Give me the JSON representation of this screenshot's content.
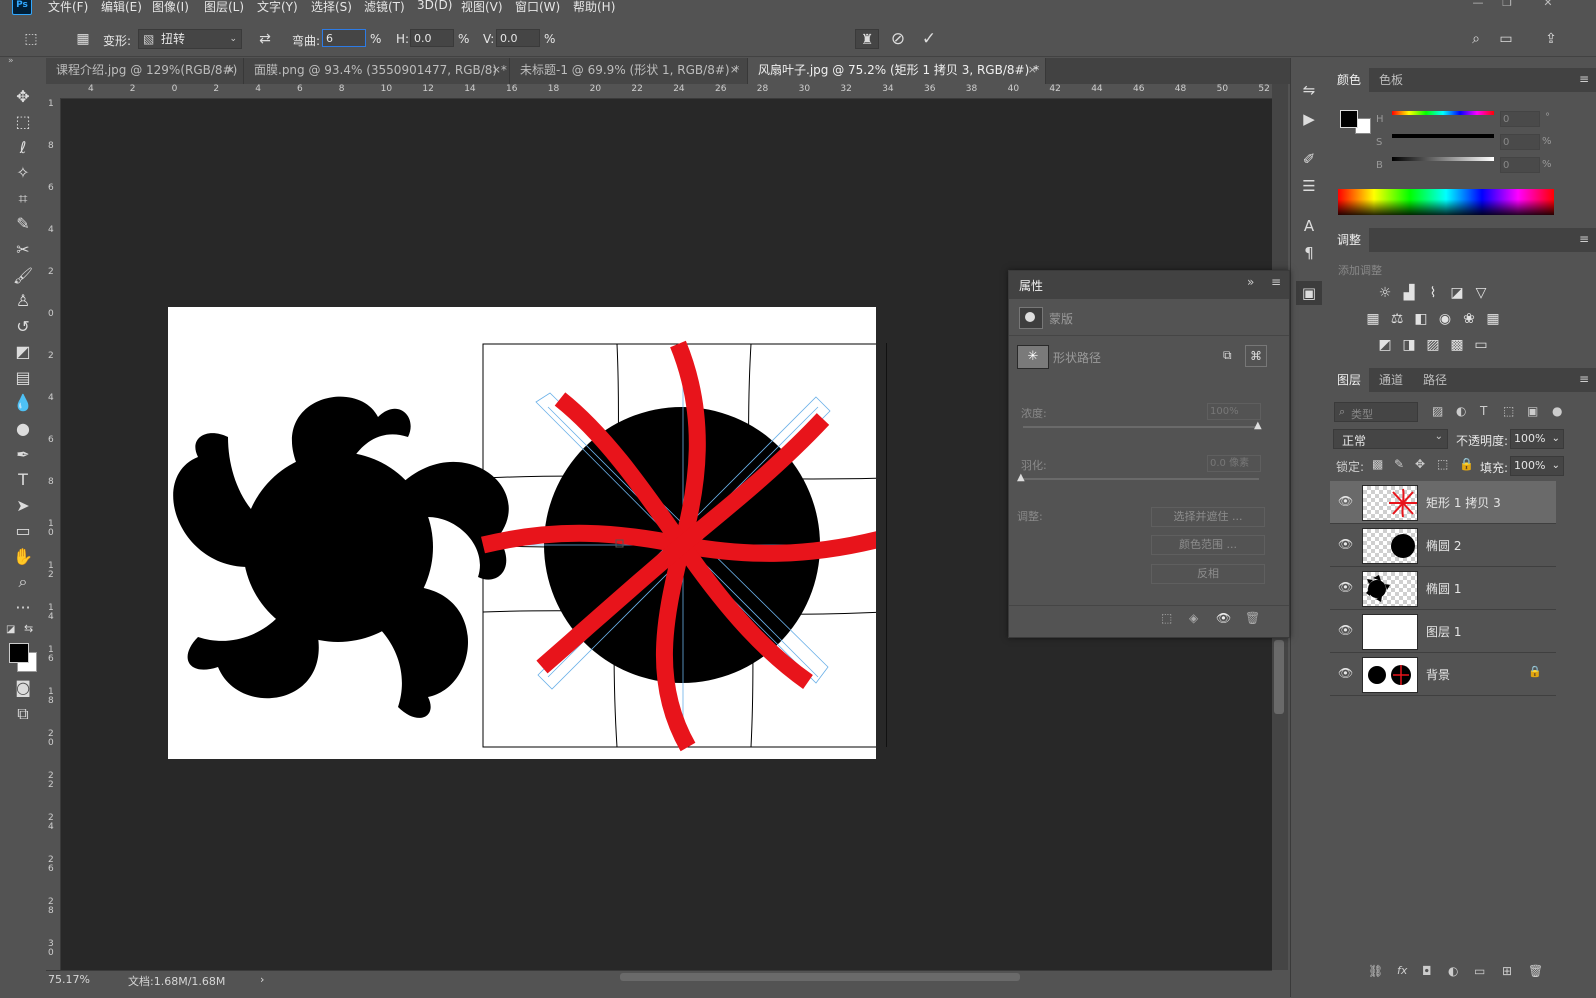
{
  "app": {
    "logo": "Ps"
  },
  "menu": [
    "文件(F)",
    "编辑(E)",
    "图像(I)",
    "图层(L)",
    "文字(Y)",
    "选择(S)",
    "滤镜(T)",
    "3D(D)",
    "视图(V)",
    "窗口(W)",
    "帮助(H)"
  ],
  "window_controls": [
    "—",
    "❐",
    "✕"
  ],
  "options": {
    "warp_label": "变形:",
    "warp_value": "扭转",
    "bend_label": "弯曲:",
    "bend_value": "6",
    "pct1": "%",
    "h_label": "H:",
    "h_value": "0.0",
    "pct2": "%",
    "v_label": "V:",
    "v_value": "0.0",
    "pct3": "%",
    "cancel_icon": "cancel-icon",
    "commit_icon": "commit-icon"
  },
  "tabs": [
    {
      "label": "课程介绍.jpg @ 129%(RGB/8#)",
      "close": "×"
    },
    {
      "label": "面膜.png @ 93.4% (3550901477, RGB/8) *",
      "close": "×"
    },
    {
      "label": "未标题-1 @ 69.9% (形状 1, RGB/8#) *",
      "close": "×"
    },
    {
      "label": "风扇叶子.jpg @ 75.2% (矩形 1 拷贝 3, RGB/8#) *",
      "close": "×"
    }
  ],
  "ruler_top": [
    "4",
    "2",
    "0",
    "2",
    "4",
    "6",
    "8",
    "10",
    "12",
    "14",
    "16",
    "18",
    "20",
    "22",
    "24",
    "26",
    "28",
    "30",
    "32",
    "34",
    "36",
    "38",
    "40",
    "42",
    "44",
    "46",
    "48",
    "50",
    "52"
  ],
  "ruler_left": [
    "1",
    "8",
    "6",
    "4",
    "2",
    "0",
    "2",
    "4",
    "6",
    "8",
    "1 0",
    "1 2",
    "1 4",
    "1 6",
    "1 8",
    "2 0",
    "2 2",
    "2 4",
    "2 6",
    "2 8",
    "3 0"
  ],
  "status": {
    "zoom": "75.17%",
    "doc": "文档:1.68M/1.68M",
    "arrow": "›"
  },
  "color_panel": {
    "tabs": [
      "颜色",
      "色板"
    ],
    "h": "H",
    "s": "S",
    "b": "B",
    "h_value": "0",
    "s_value": "0",
    "b_value": "0",
    "h_unit": "°",
    "s_unit": "%",
    "b_unit": "%"
  },
  "adjust_panel": {
    "title": "调整",
    "subtitle": "添加调整"
  },
  "properties": {
    "title": "属性",
    "mask_label": "蒙版",
    "vector_label": "形状路径",
    "density_label": "浓度:",
    "density_value": "100%",
    "feather_label": "羽化:",
    "feather_value": "0.0 像素",
    "refine_label": "调整:",
    "btn_select_mask": "选择并遮住 ...",
    "btn_color_range": "颜色范围 ...",
    "btn_invert": "反相"
  },
  "layers_panel": {
    "tabs": [
      "图层",
      "通道",
      "路径"
    ],
    "filter_placeholder": "类型",
    "blend_mode": "正常",
    "opacity_label": "不透明度:",
    "opacity_value": "100%",
    "lock_label": "锁定:",
    "fill_label": "填充:",
    "fill_value": "100%",
    "layers": [
      {
        "name": "矩形 1 拷贝 3",
        "selected": true
      },
      {
        "name": "椭圆 2",
        "selected": false
      },
      {
        "name": "椭圆 1",
        "selected": false
      },
      {
        "name": "图层 1",
        "selected": false
      },
      {
        "name": "背景",
        "selected": false
      }
    ]
  },
  "colors": {
    "accent": "#2d7be5",
    "red_shape": "#e8141b",
    "bg": "#535353",
    "canvas": "#282828"
  }
}
